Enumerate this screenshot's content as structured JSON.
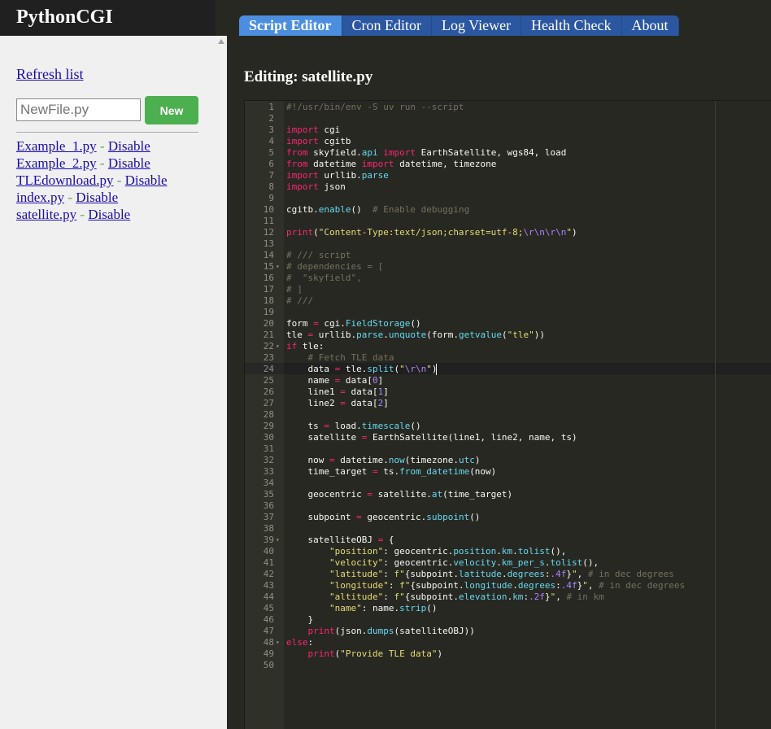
{
  "app": {
    "brand": "PythonCGI"
  },
  "tabs": [
    {
      "label": "Script Editor",
      "active": true
    },
    {
      "label": "Cron Editor",
      "active": false
    },
    {
      "label": "Log Viewer",
      "active": false
    },
    {
      "label": "Health Check",
      "active": false
    },
    {
      "label": "About",
      "active": false
    }
  ],
  "sidebar": {
    "refresh_label": "Refresh list",
    "new_file_placeholder": "NewFile.py",
    "new_button_label": "New",
    "files": [
      {
        "name": "Example_1.py",
        "separator": " - ",
        "action": "Disable"
      },
      {
        "name": "Example_2.py",
        "separator": " - ",
        "action": "Disable"
      },
      {
        "name": "TLEdownload.py",
        "separator": " - ",
        "action": "Disable"
      },
      {
        "name": "index.py",
        "separator": " - ",
        "action": "Disable"
      },
      {
        "name": "satellite.py",
        "separator": " - ",
        "action": "Disable"
      }
    ]
  },
  "editor": {
    "heading": "Editing: satellite.py",
    "active_line": 24,
    "fold_lines": [
      15,
      22,
      39,
      48
    ],
    "lines": [
      [
        [
          "c",
          "#!/usr/bin/env -S uv run --script"
        ]
      ],
      [],
      [
        [
          "k",
          "import"
        ],
        [
          "",
          " cgi"
        ]
      ],
      [
        [
          "k",
          "import"
        ],
        [
          "",
          " cgitb"
        ]
      ],
      [
        [
          "k",
          "from"
        ],
        [
          "",
          " skyfield."
        ],
        [
          "f",
          "api"
        ],
        [
          "",
          " "
        ],
        [
          "k",
          "import"
        ],
        [
          "",
          " EarthSatellite, wgs84, load"
        ]
      ],
      [
        [
          "k",
          "from"
        ],
        [
          "",
          " datetime "
        ],
        [
          "k",
          "import"
        ],
        [
          "",
          " datetime, timezone"
        ]
      ],
      [
        [
          "k",
          "import"
        ],
        [
          "",
          " urllib."
        ],
        [
          "f",
          "parse"
        ]
      ],
      [
        [
          "k",
          "import"
        ],
        [
          "",
          " json"
        ]
      ],
      [],
      [
        [
          "",
          "cgitb."
        ],
        [
          "f",
          "enable"
        ],
        [
          "",
          "()  "
        ],
        [
          "c",
          "# Enable debugging"
        ]
      ],
      [],
      [
        [
          "k",
          "print"
        ],
        [
          "",
          "("
        ],
        [
          "s",
          "\"Content-Type:text/json;charset=utf-8;"
        ],
        [
          "n",
          "\\r\\n\\r\\n"
        ],
        [
          "s",
          "\""
        ],
        [
          "",
          ")"
        ]
      ],
      [],
      [
        [
          "c",
          "# /// script"
        ]
      ],
      [
        [
          "c",
          "# dependencies = ["
        ]
      ],
      [
        [
          "c",
          "#  \"skyfield\","
        ]
      ],
      [
        [
          "c",
          "# ]"
        ]
      ],
      [
        [
          "c",
          "# ///"
        ]
      ],
      [],
      [
        [
          "",
          "form "
        ],
        [
          "k",
          "="
        ],
        [
          "",
          " cgi."
        ],
        [
          "f",
          "FieldStorage"
        ],
        [
          "",
          "()"
        ]
      ],
      [
        [
          "",
          "tle "
        ],
        [
          "k",
          "="
        ],
        [
          "",
          " urllib."
        ],
        [
          "f",
          "parse"
        ],
        [
          "",
          "."
        ],
        [
          "f",
          "unquote"
        ],
        [
          "",
          "(form."
        ],
        [
          "f",
          "getvalue"
        ],
        [
          "",
          "("
        ],
        [
          "s",
          "\"tle\""
        ],
        [
          "",
          "))"
        ]
      ],
      [
        [
          "k",
          "if"
        ],
        [
          "",
          " tle:"
        ]
      ],
      [
        [
          "",
          "    "
        ],
        [
          "c",
          "# Fetch TLE data"
        ]
      ],
      [
        [
          "",
          "    data "
        ],
        [
          "k",
          "="
        ],
        [
          "",
          " tle."
        ],
        [
          "f",
          "split"
        ],
        [
          "",
          "("
        ],
        [
          "s",
          "\""
        ],
        [
          "n",
          "\\r\\n"
        ],
        [
          "s",
          "\""
        ],
        [
          "",
          ")"
        ]
      ],
      [
        [
          "",
          "    name "
        ],
        [
          "k",
          "="
        ],
        [
          "",
          " data["
        ],
        [
          "n",
          "0"
        ],
        [
          "",
          "]"
        ]
      ],
      [
        [
          "",
          "    line1 "
        ],
        [
          "k",
          "="
        ],
        [
          "",
          " data["
        ],
        [
          "n",
          "1"
        ],
        [
          "",
          "]"
        ]
      ],
      [
        [
          "",
          "    line2 "
        ],
        [
          "k",
          "="
        ],
        [
          "",
          " data["
        ],
        [
          "n",
          "2"
        ],
        [
          "",
          "]"
        ]
      ],
      [],
      [
        [
          "",
          "    ts "
        ],
        [
          "k",
          "="
        ],
        [
          "",
          " load."
        ],
        [
          "f",
          "timescale"
        ],
        [
          "",
          "()"
        ]
      ],
      [
        [
          "",
          "    satellite "
        ],
        [
          "k",
          "="
        ],
        [
          "",
          " EarthSatellite(line1, line2, name, ts)"
        ]
      ],
      [],
      [
        [
          "",
          "    now "
        ],
        [
          "k",
          "="
        ],
        [
          "",
          " datetime."
        ],
        [
          "f",
          "now"
        ],
        [
          "",
          "(timezone."
        ],
        [
          "f",
          "utc"
        ],
        [
          "",
          ")"
        ]
      ],
      [
        [
          "",
          "    time_target "
        ],
        [
          "k",
          "="
        ],
        [
          "",
          " ts."
        ],
        [
          "f",
          "from_datetime"
        ],
        [
          "",
          "(now)"
        ]
      ],
      [],
      [
        [
          "",
          "    geocentric "
        ],
        [
          "k",
          "="
        ],
        [
          "",
          " satellite."
        ],
        [
          "f",
          "at"
        ],
        [
          "",
          "(time_target)"
        ]
      ],
      [],
      [
        [
          "",
          "    subpoint "
        ],
        [
          "k",
          "="
        ],
        [
          "",
          " geocentric."
        ],
        [
          "f",
          "subpoint"
        ],
        [
          "",
          "()"
        ]
      ],
      [],
      [
        [
          "",
          "    satelliteOBJ "
        ],
        [
          "k",
          "="
        ],
        [
          "",
          " {"
        ]
      ],
      [
        [
          "",
          "        "
        ],
        [
          "s",
          "\"position\""
        ],
        [
          "",
          ": geocentric."
        ],
        [
          "f",
          "position"
        ],
        [
          "",
          "."
        ],
        [
          "f",
          "km"
        ],
        [
          "",
          "."
        ],
        [
          "f",
          "tolist"
        ],
        [
          "",
          "(),"
        ]
      ],
      [
        [
          "",
          "        "
        ],
        [
          "s",
          "\"velocity\""
        ],
        [
          "",
          ": geocentric."
        ],
        [
          "f",
          "velocity"
        ],
        [
          "",
          "."
        ],
        [
          "f",
          "km_per_s"
        ],
        [
          "",
          "."
        ],
        [
          "f",
          "tolist"
        ],
        [
          "",
          "(),"
        ]
      ],
      [
        [
          "",
          "        "
        ],
        [
          "s",
          "\"latitude\""
        ],
        [
          "",
          ": "
        ],
        [
          "s",
          "f\""
        ],
        [
          "",
          "{subpoint."
        ],
        [
          "f",
          "latitude"
        ],
        [
          "",
          "."
        ],
        [
          "f",
          "degrees"
        ],
        [
          "",
          ":"
        ],
        [
          "n",
          ".4f"
        ],
        [
          "",
          "}"
        ],
        [
          "s",
          "\""
        ],
        [
          "",
          ", "
        ],
        [
          "c",
          "# in dec degrees"
        ]
      ],
      [
        [
          "",
          "        "
        ],
        [
          "s",
          "\"longitude\""
        ],
        [
          "",
          ": "
        ],
        [
          "s",
          "f\""
        ],
        [
          "",
          "{subpoint."
        ],
        [
          "f",
          "longitude"
        ],
        [
          "",
          "."
        ],
        [
          "f",
          "degrees"
        ],
        [
          "",
          ":"
        ],
        [
          "n",
          ".4f"
        ],
        [
          "",
          "}"
        ],
        [
          "s",
          "\""
        ],
        [
          "",
          ", "
        ],
        [
          "c",
          "# in dec degrees"
        ]
      ],
      [
        [
          "",
          "        "
        ],
        [
          "s",
          "\"altitude\""
        ],
        [
          "",
          ": "
        ],
        [
          "s",
          "f\""
        ],
        [
          "",
          "{subpoint."
        ],
        [
          "f",
          "elevation"
        ],
        [
          "",
          "."
        ],
        [
          "f",
          "km"
        ],
        [
          "",
          ":"
        ],
        [
          "n",
          ".2f"
        ],
        [
          "",
          "}"
        ],
        [
          "s",
          "\""
        ],
        [
          "",
          ", "
        ],
        [
          "c",
          "# in km"
        ]
      ],
      [
        [
          "",
          "        "
        ],
        [
          "s",
          "\"name\""
        ],
        [
          "",
          ": name."
        ],
        [
          "f",
          "strip"
        ],
        [
          "",
          "()"
        ]
      ],
      [
        [
          "",
          "    }"
        ]
      ],
      [
        [
          "",
          "    "
        ],
        [
          "k",
          "print"
        ],
        [
          "",
          "(json."
        ],
        [
          "f",
          "dumps"
        ],
        [
          "",
          "(satelliteOBJ))"
        ]
      ],
      [
        [
          "k",
          "else"
        ],
        [
          "",
          ":"
        ]
      ],
      [
        [
          "",
          "    "
        ],
        [
          "k",
          "print"
        ],
        [
          "",
          "("
        ],
        [
          "s",
          "\"Provide TLE data\""
        ],
        [
          "",
          ")"
        ]
      ],
      []
    ]
  },
  "colors": {
    "editor_bg": "#272822",
    "sidebar_bg": "#f0f0f0",
    "tab_bg": "#2b57a0",
    "tab_active_bg": "#4b8ede",
    "new_button_bg": "#4caf50",
    "link": "#1a0dab"
  }
}
